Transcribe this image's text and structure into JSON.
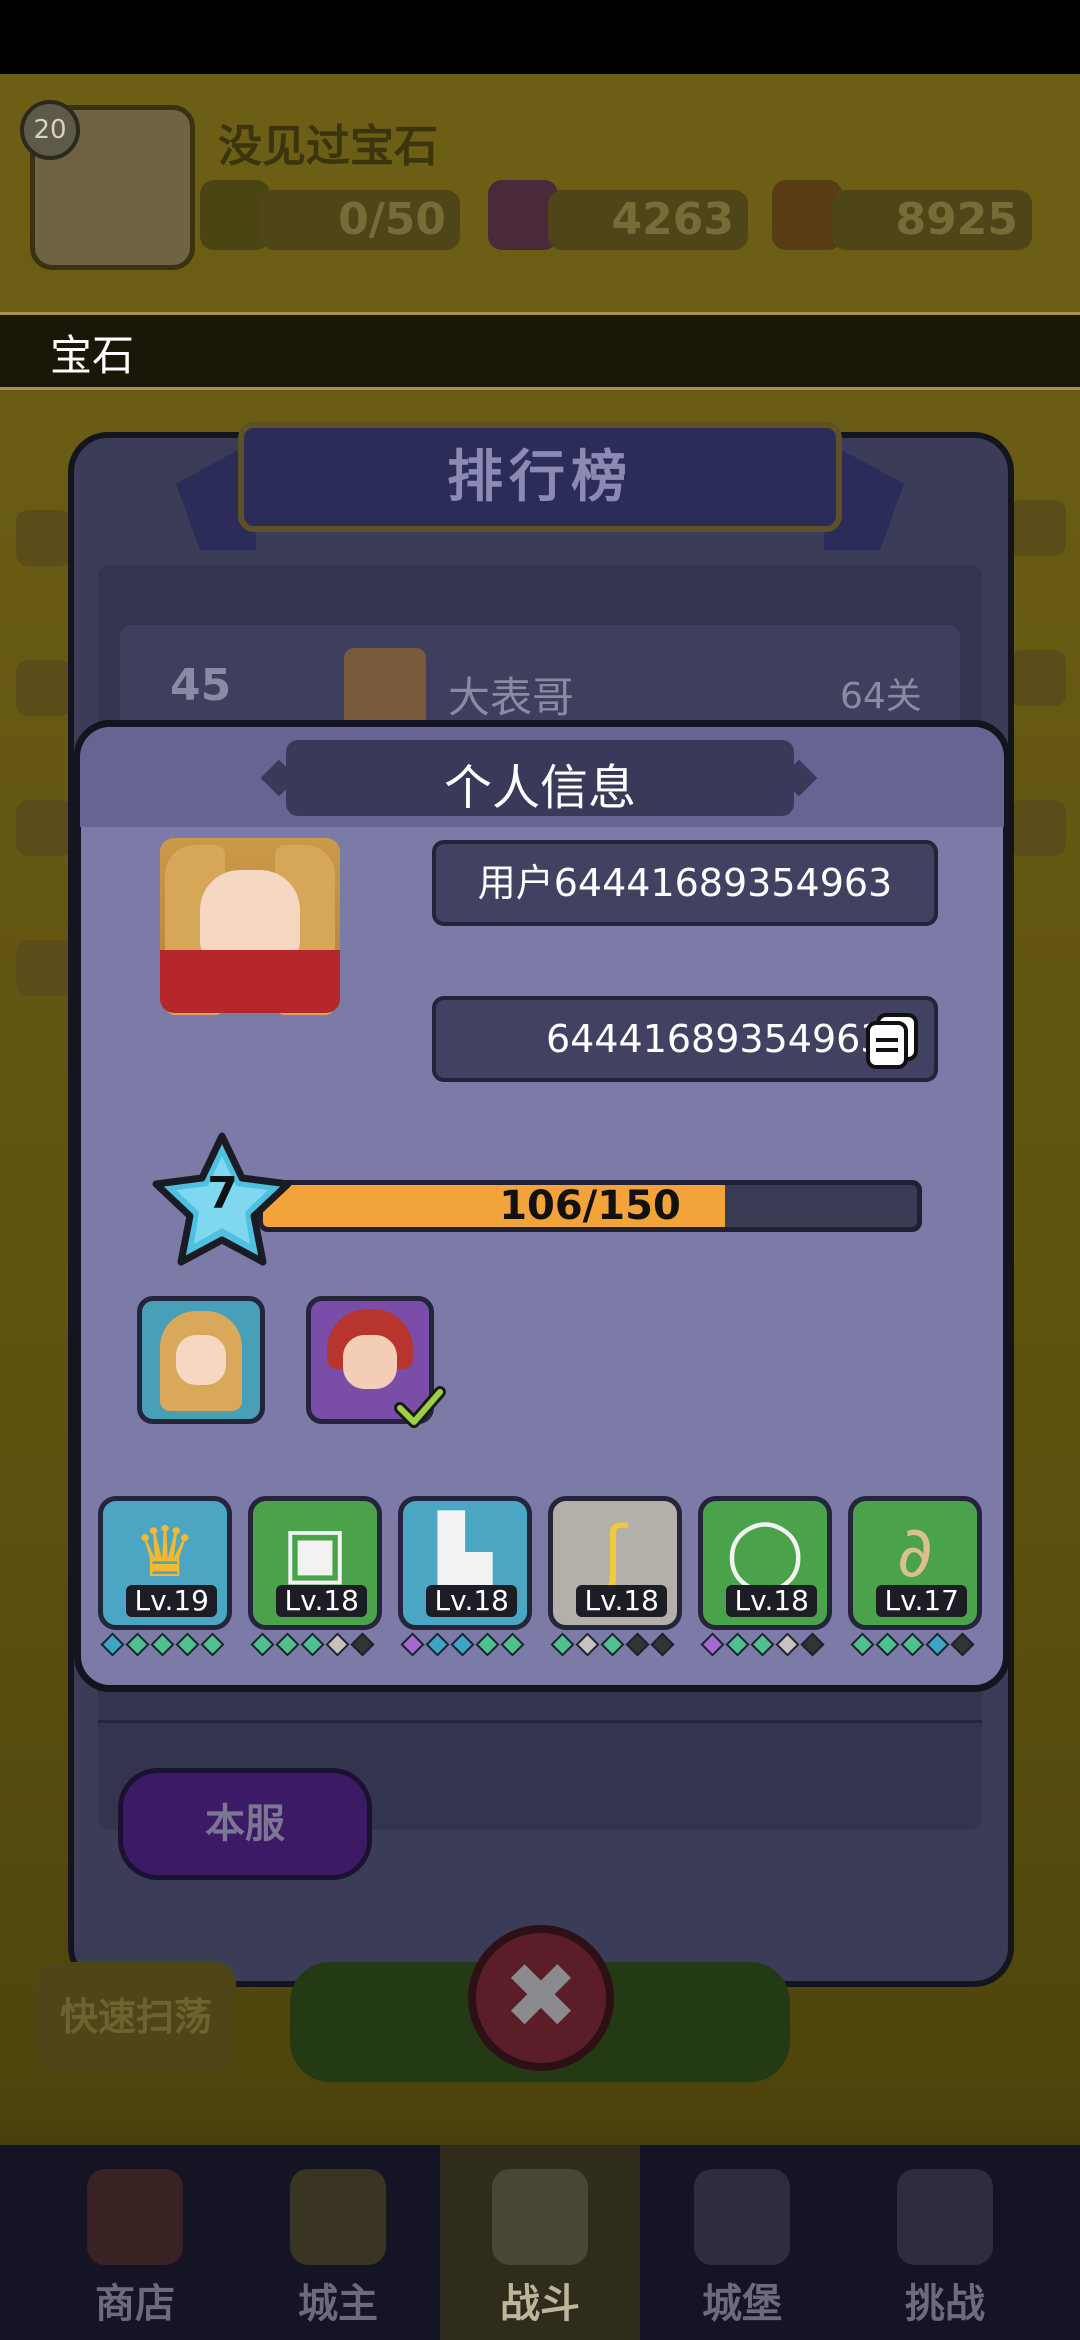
{
  "player": {
    "name": "没见过宝石",
    "level": "20",
    "energy": "0/50",
    "gems": "4263",
    "coins": "8925"
  },
  "announcement": "宝石",
  "leaderboard": {
    "title": "排行榜",
    "row": {
      "rank": "45",
      "name": "大表哥",
      "stage": "64关"
    },
    "server_button": "本服"
  },
  "bg_buttons": {
    "quick_sweep": "快速扫荡"
  },
  "bottom_nav": [
    {
      "label": "商店",
      "icon": "shop-icon"
    },
    {
      "label": "城主",
      "icon": "crown-icon"
    },
    {
      "label": "战斗",
      "icon": "sword-icon",
      "active": true
    },
    {
      "label": "城堡",
      "icon": "castle-icon"
    },
    {
      "label": "挑战",
      "icon": "challenge-icon"
    }
  ],
  "profile": {
    "title": "个人信息",
    "username": "用户64441689354963",
    "user_id": "64441689354963",
    "level": "7",
    "xp_text": "106/150",
    "xp_fraction": 0.7067,
    "heroes": [
      {
        "name": "blonde-hero",
        "selected": false
      },
      {
        "name": "elf-hero",
        "selected": true
      }
    ],
    "equipment": [
      {
        "slot": "crown",
        "level": "Lv.19",
        "bg": "#4aa6c3",
        "gems": [
          "#3da5c8",
          "#4fc08f",
          "#4fc08f",
          "#4fc08f",
          "#4fc08f"
        ]
      },
      {
        "slot": "armor",
        "level": "Lv.18",
        "bg": "#4aa34b",
        "gems": [
          "#4fc08f",
          "#4fc08f",
          "#4fc08f",
          "#c7c2c0",
          "#333"
        ]
      },
      {
        "slot": "boots",
        "level": "Lv.18",
        "bg": "#4aa6c3",
        "gems": [
          "#a36ad1",
          "#3da5c8",
          "#3da5c8",
          "#4fc08f",
          "#4fc08f"
        ]
      },
      {
        "slot": "staff",
        "level": "Lv.18",
        "bg": "#b4afa8",
        "gems": [
          "#4fc08f",
          "#c7c2c0",
          "#4fc08f",
          "#333",
          "#333"
        ]
      },
      {
        "slot": "ring",
        "level": "Lv.18",
        "bg": "#4aa34b",
        "gems": [
          "#a36ad1",
          "#4fc08f",
          "#4fc08f",
          "#c7c2c0",
          "#333"
        ]
      },
      {
        "slot": "scarf",
        "level": "Lv.17",
        "bg": "#4aa34b",
        "gems": [
          "#4fc08f",
          "#4fc08f",
          "#4fc08f",
          "#3da5c8",
          "#333"
        ]
      }
    ]
  }
}
